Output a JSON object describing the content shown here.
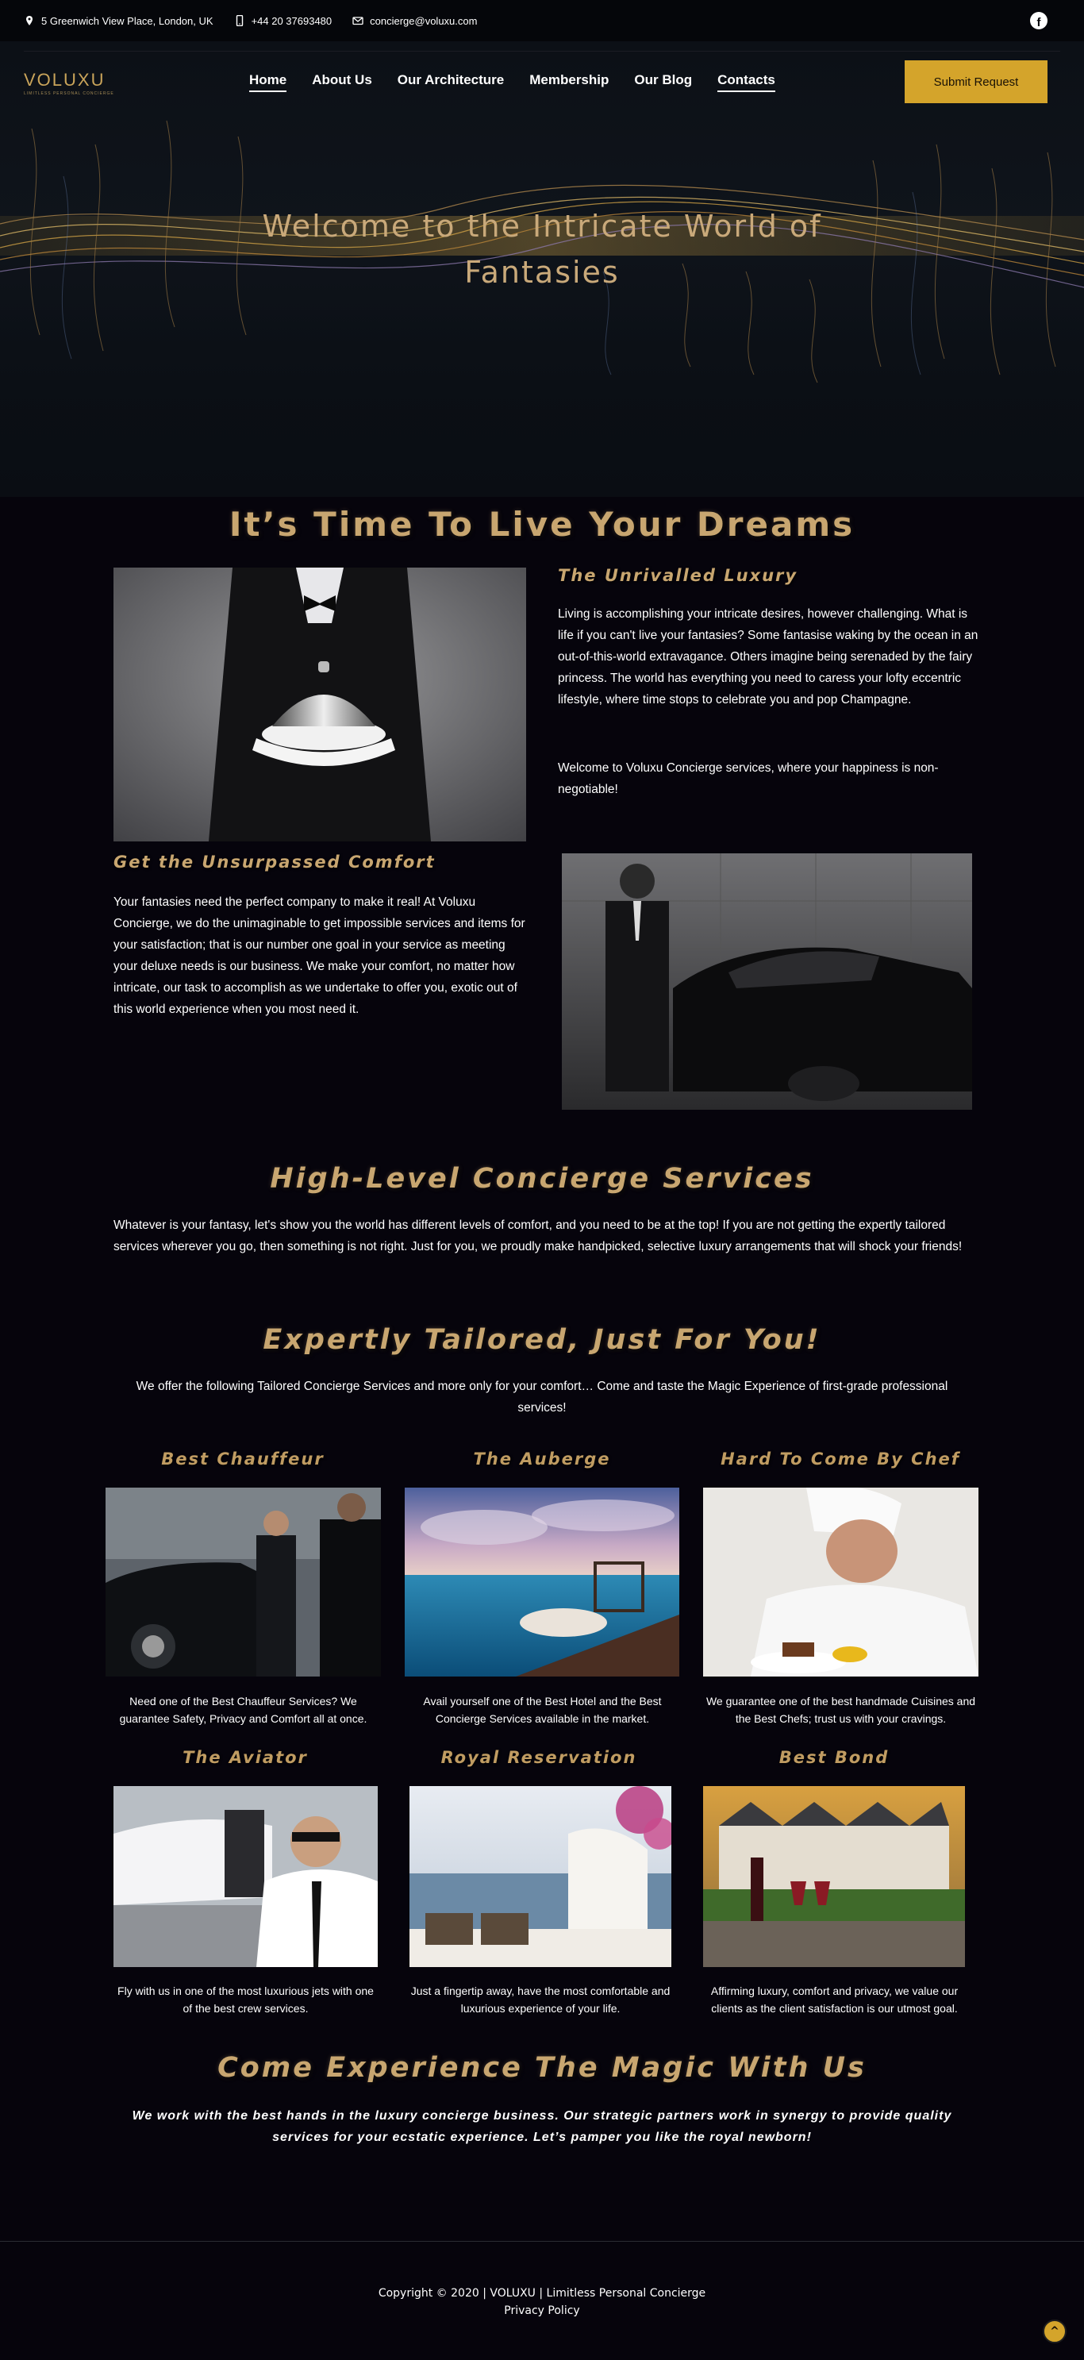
{
  "topbar": {
    "address": "5 Greenwich View Place, London, UK",
    "phone": "+44 20 37693480",
    "email": "concierge@voluxu.com",
    "social_icon": "facebook-icon"
  },
  "nav": {
    "logo": "VOLUXU",
    "logo_tagline": "LIMITLESS PERSONAL CONCIERGE",
    "items": [
      {
        "label": "Home"
      },
      {
        "label": "About Us"
      },
      {
        "label": "Our Architecture"
      },
      {
        "label": "Membership"
      },
      {
        "label": "Our Blog"
      },
      {
        "label": "Contacts"
      }
    ],
    "cta": "Submit Request"
  },
  "hero": {
    "title": "Welcome to the Intricate World of Fantasies"
  },
  "dreams": {
    "title": "It’s Time To Live Your Dreams",
    "luxury_title": "The Unrivalled Luxury",
    "luxury_p1": "Living is accomplishing your intricate desires, however challenging. What is life if you can't live your fantasies? Some fantasise waking by the ocean in an out-of-this-world extravagance. Others imagine being serenaded by the fairy princess. The world has everything you need to caress your lofty eccentric lifestyle, where time stops to celebrate you and pop Champagne.",
    "luxury_p2": "Welcome to Voluxu Concierge services, where your happiness is non-negotiable!",
    "comfort_title": "Get the Unsurpassed Comfort",
    "comfort_p": "Your fantasies need the perfect company to make it real! At Voluxu Concierge, we do the unimaginable to get impossible services and items for your satisfaction; that is our number one goal in your service as meeting your deluxe needs is our business. We make your comfort, no matter how intricate, our task to accomplish as we undertake to offer you, exotic out of this world experience when you most need it."
  },
  "high_level": {
    "title": "High-Level Concierge Services",
    "text": "Whatever is your fantasy, let's show you the world has different levels of comfort, and you need to be at the top! If you are not getting the expertly tailored services wherever you go, then something is not right. Just for you, we proudly make handpicked, selective luxury arrangements that will shock your friends!"
  },
  "tailored": {
    "title": "Expertly Tailored, Just For You!",
    "text": "We offer the following Tailored Concierge Services and more only for your comfort… Come and taste the Magic Experience of first-grade professional services!"
  },
  "services": [
    {
      "title": "Best Chauffeur",
      "desc": "Need one of the Best Chauffeur Services? We guarantee Safety, Privacy and Comfort all at once."
    },
    {
      "title": "The Auberge",
      "desc": "Avail yourself one of the Best Hotel and the Best Concierge Services available in the market."
    },
    {
      "title": "Hard To Come By Chef",
      "desc": "We guarantee one of the best handmade Cuisines and the Best Chefs; trust us with your cravings."
    },
    {
      "title": "The Aviator",
      "desc": "Fly with us in one of the most luxurious jets with one of the best crew services."
    },
    {
      "title": "Royal Reservation",
      "desc": "Just a fingertip away, have the most comfortable and luxurious experience of your life."
    },
    {
      "title": "Best Bond",
      "desc": "Affirming luxury, comfort and privacy, we value our clients as the client satisfaction is our utmost goal."
    }
  ],
  "magic": {
    "title": "Come Experience The Magic With Us",
    "text": "We work with the best hands in the luxury concierge business. Our strategic partners work in synergy to provide quality services for your ecstatic experience. Let’s pamper you like the royal newborn!"
  },
  "footer": {
    "copyright": "Copyright © 2020 | VOLUXU | Limitless Personal Concierge",
    "privacy": "Privacy Policy",
    "to_top_icon": "chevron-up-icon"
  },
  "colors": {
    "accent_gold": "#d4a42b",
    "title_gold": "#c8a670",
    "background": "#06040c"
  }
}
